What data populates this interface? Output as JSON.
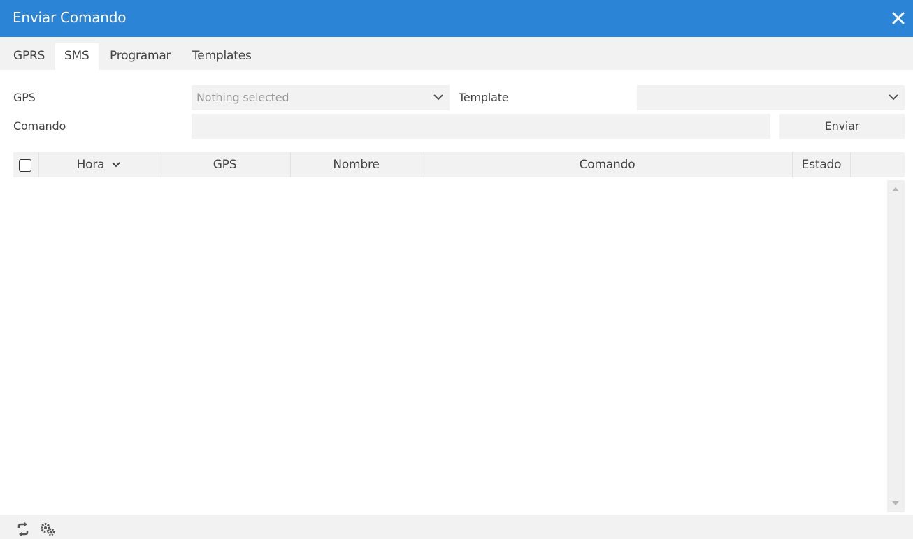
{
  "window": {
    "title": "Enviar Comando",
    "accent_color": "#2b84d6",
    "close_icon": "close-icon"
  },
  "tabs": [
    {
      "label": "GPRS",
      "active": false
    },
    {
      "label": "SMS",
      "active": true
    },
    {
      "label": "Programar",
      "active": false
    },
    {
      "label": "Templates",
      "active": false
    }
  ],
  "form": {
    "gps_label": "GPS",
    "gps_select_value": "Nothing selected",
    "template_label": "Template",
    "template_select_value": "",
    "comando_label": "Comando",
    "comando_value": "",
    "send_button": "Enviar"
  },
  "table": {
    "columns": [
      "Hora",
      "GPS",
      "Nombre",
      "Comando",
      "Estado"
    ],
    "sort_column": "Hora",
    "sort_direction": "descending",
    "rows": []
  },
  "footer": {
    "icons": [
      "refresh-icon",
      "settings-icon"
    ]
  }
}
